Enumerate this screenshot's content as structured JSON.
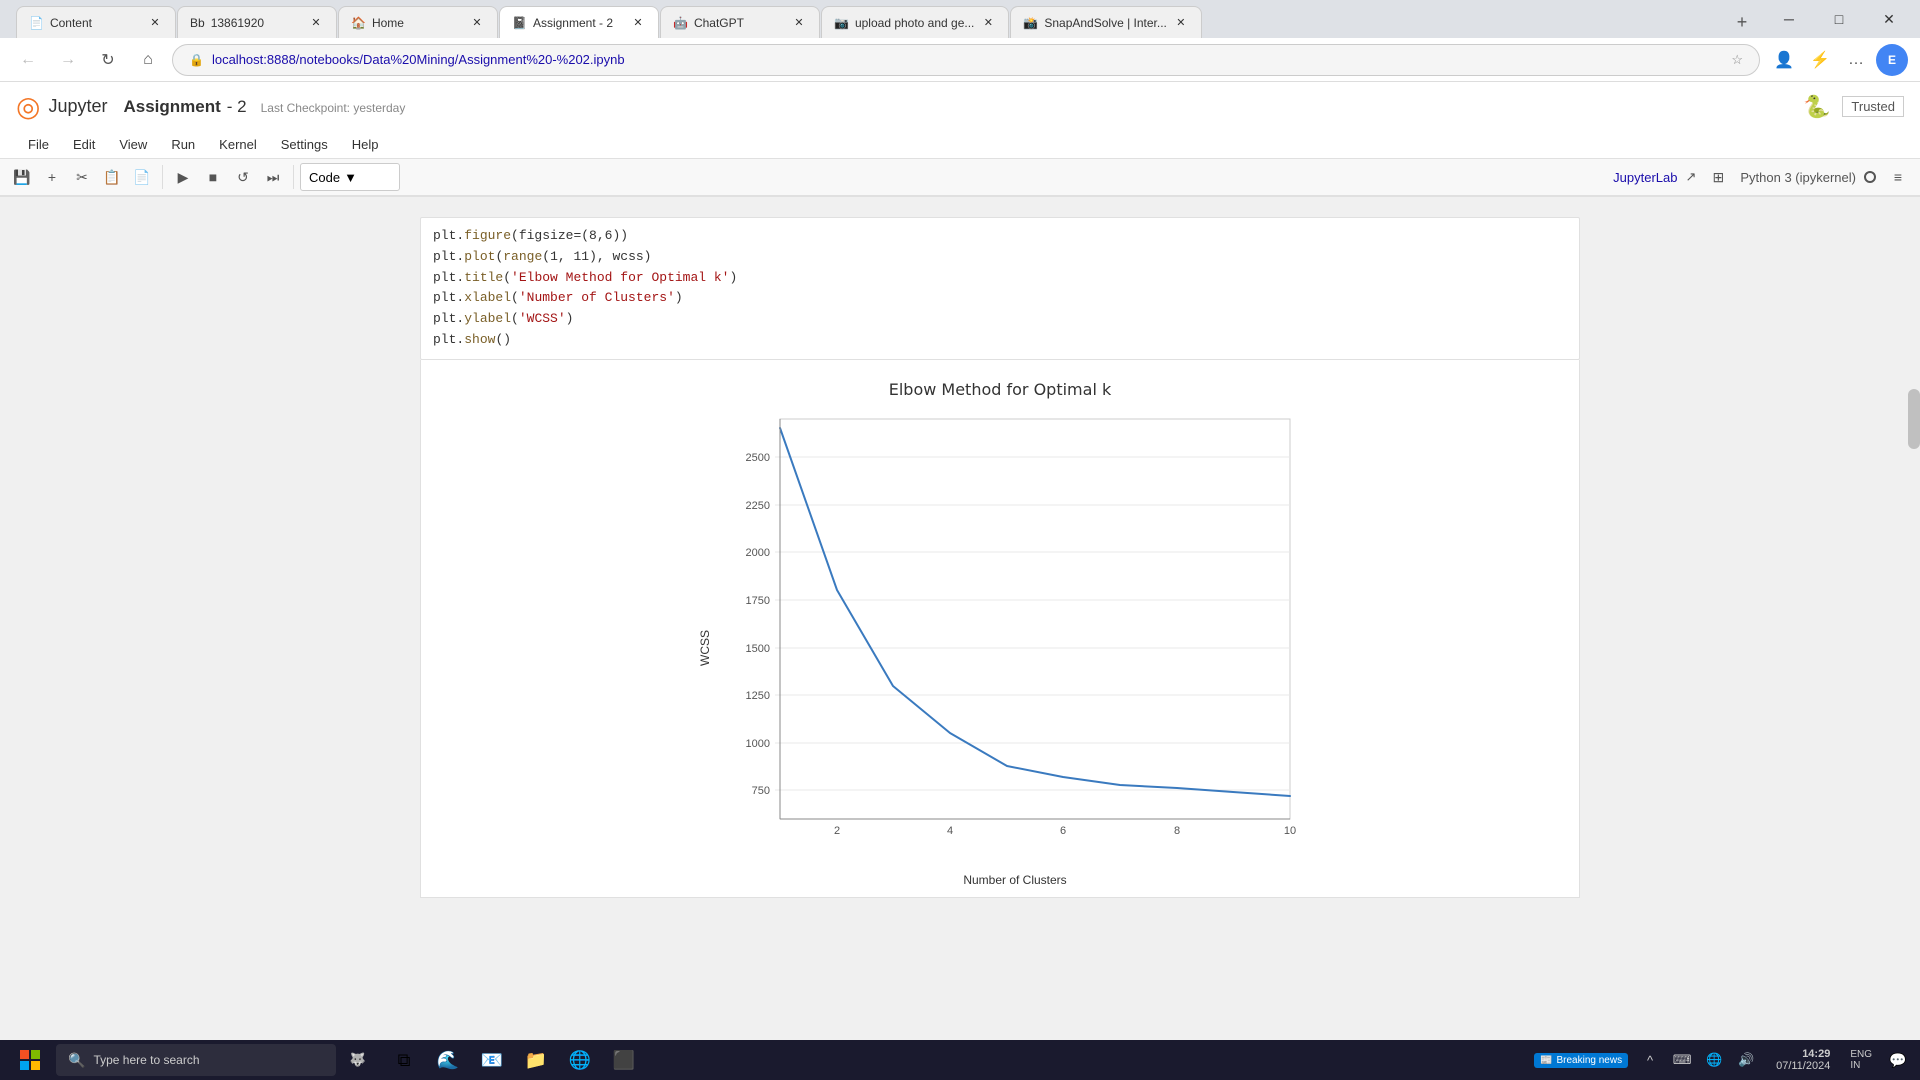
{
  "browser": {
    "tabs": [
      {
        "id": "content",
        "title": "Content",
        "favicon": "📄",
        "active": false
      },
      {
        "id": "13861920",
        "title": "13861920",
        "favicon": "Bb",
        "active": false
      },
      {
        "id": "home",
        "title": "Home",
        "favicon": "🏠",
        "active": false
      },
      {
        "id": "assignment",
        "title": "Assignment - 2",
        "favicon": "📓",
        "active": true
      },
      {
        "id": "chatgpt",
        "title": "ChatGPT",
        "favicon": "🤖",
        "active": false
      },
      {
        "id": "upload",
        "title": "upload photo and ge...",
        "favicon": "📷",
        "active": false
      },
      {
        "id": "snapsolve",
        "title": "SnapAndSolve | Inter...",
        "favicon": "📸",
        "active": false
      }
    ],
    "address": "localhost:8888/notebooks/Data%20Mining/Assignment%20-%202.ipynb"
  },
  "jupyter": {
    "logo": "◎",
    "logo_text": "Jupyter",
    "notebook_title": "Assignment - 2",
    "assignment_label": "Assignment",
    "number_label": "- 2",
    "checkpoint_text": "Last Checkpoint: yesterday",
    "trusted_label": "Trusted",
    "menu": [
      "File",
      "Edit",
      "View",
      "Run",
      "Kernel",
      "Settings",
      "Help"
    ],
    "toolbar": {
      "cell_type": "Code",
      "jupyterlab_label": "JupyterLab",
      "python_label": "Python 3 (ipykernel)"
    },
    "code_lines": [
      "plt.figure(figsize=(8,6))",
      "plt.plot(range(1, 11), wcss)",
      "plt.title('Elbow Method for Optimal k')",
      "plt.xlabel('Number of Clusters')",
      "plt.ylabel('WCSS')",
      "plt.show()"
    ],
    "chart": {
      "title": "Elbow Method for Optimal k",
      "y_label": "WCSS",
      "x_label": "Number of Clusters",
      "y_ticks": [
        750,
        1000,
        1250,
        1500,
        1750,
        2000,
        2250,
        2500
      ],
      "x_ticks": [
        2,
        4,
        6,
        8,
        10
      ],
      "data_points": [
        {
          "x": 1,
          "y": 2650
        },
        {
          "x": 2,
          "y": 1800
        },
        {
          "x": 3,
          "y": 1300
        },
        {
          "x": 4,
          "y": 1050
        },
        {
          "x": 5,
          "y": 880
        },
        {
          "x": 6,
          "y": 820
        },
        {
          "x": 7,
          "y": 780
        },
        {
          "x": 8,
          "y": 760
        },
        {
          "x": 9,
          "y": 740
        },
        {
          "x": 10,
          "y": 720
        }
      ],
      "color": "#3a7abf"
    }
  },
  "taskbar": {
    "search_placeholder": "Type here to search",
    "news_label": "Breaking news",
    "clock_time": "14:29",
    "clock_date": "07/11/2024",
    "locale": "ENG\nIN",
    "icons": [
      "🗂",
      "🌊",
      "📧",
      "📁",
      "🌐",
      "⬛"
    ]
  }
}
